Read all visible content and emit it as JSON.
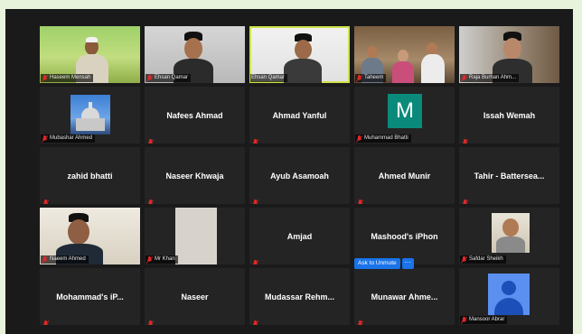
{
  "meeting": {
    "active_speaker": "Ehsan Qamar",
    "participants": [
      {
        "name": "Haseem Mensah",
        "video": true,
        "muted": true
      },
      {
        "name": "Ehsan Qamar",
        "video": true,
        "muted": true
      },
      {
        "name": "Ehsan Qamar",
        "video": true,
        "muted": false,
        "active": true
      },
      {
        "name": "Taheem",
        "video": true,
        "muted": true
      },
      {
        "name": "Raja Burhan Ahm...",
        "video": true,
        "muted": true
      },
      {
        "name": "Mubashar Ahmed",
        "video": true,
        "muted": true
      },
      {
        "name": "Nafees Ahmad",
        "video": false,
        "muted": true
      },
      {
        "name": "Ahmad Yanful",
        "video": false,
        "muted": true
      },
      {
        "name": "Muhammad Bhatti",
        "video": false,
        "muted": true,
        "avatar_letter": "M",
        "avatar_color": "#0a8a7a"
      },
      {
        "name": "Issah Wemah",
        "video": false,
        "muted": true
      },
      {
        "name": "zahid bhatti",
        "video": false,
        "muted": true
      },
      {
        "name": "Naseer Khwaja",
        "video": false,
        "muted": true
      },
      {
        "name": "Ayub Asamoah",
        "video": false,
        "muted": true
      },
      {
        "name": "Ahmed Munir",
        "video": false,
        "muted": true
      },
      {
        "name": "Tahir - Battersea...",
        "video": false,
        "muted": true
      },
      {
        "name": "Naeem Ahmed",
        "video": true,
        "muted": true
      },
      {
        "name": "Mr Khan",
        "video": true,
        "muted": true
      },
      {
        "name": "Amjad",
        "video": false,
        "muted": true
      },
      {
        "name": "Mashood's iPhon",
        "video": false,
        "muted": true
      },
      {
        "name": "Safdar Sheikh",
        "video": true,
        "muted": true
      },
      {
        "name": "Mohammad's iP...",
        "video": false,
        "muted": true
      },
      {
        "name": "Naseer",
        "video": false,
        "muted": true
      },
      {
        "name": "Mudassar Rehm...",
        "video": false,
        "muted": true
      },
      {
        "name": "Munawar Ahme...",
        "video": false,
        "muted": true
      },
      {
        "name": "Mansoor Abrar",
        "video": false,
        "muted": true
      }
    ]
  },
  "hover_controls": {
    "unmute_label": "Ask to Unmute",
    "more_label": "···"
  },
  "colors": {
    "muted_icon": "#e02828",
    "active_border": "#cfe24a",
    "button_blue": "#1a73e8"
  }
}
